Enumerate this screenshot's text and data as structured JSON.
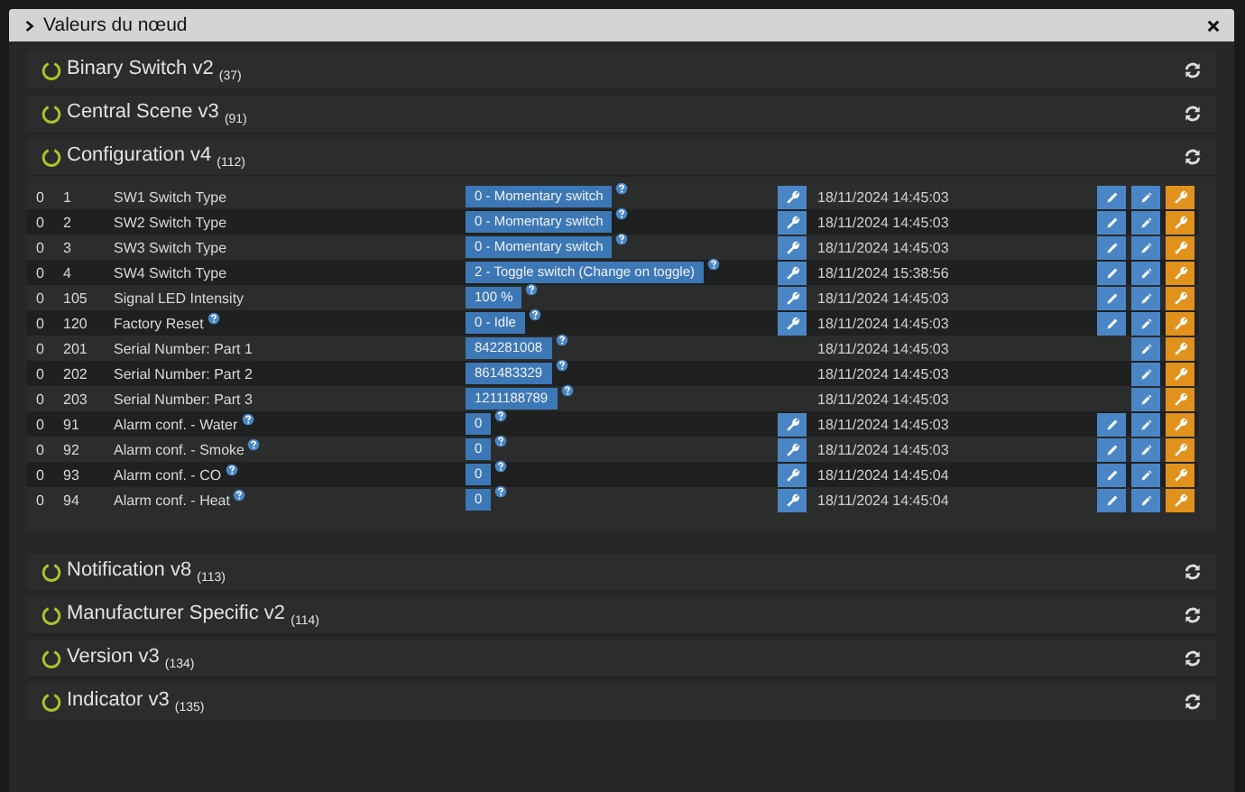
{
  "window": {
    "title": "Valeurs du nœud"
  },
  "sections": [
    {
      "title": "Binary Switch v2 $_{(37)}$"
    },
    {
      "title": "Central Scene v3 $_{(91)}$"
    },
    {
      "title": "Configuration v4 $_{(112)}$",
      "rows": [
        {
          "instance": "0",
          "index": "1",
          "label": "SW1 Switch Type",
          "label_help": false,
          "value": "0 - Momentary switch",
          "set_button": true,
          "timestamp": "18/11/2024 14:45:03",
          "edit_button": true
        },
        {
          "instance": "0",
          "index": "2",
          "label": "SW2 Switch Type",
          "label_help": false,
          "value": "0 - Momentary switch",
          "set_button": true,
          "timestamp": "18/11/2024 14:45:03",
          "edit_button": true
        },
        {
          "instance": "0",
          "index": "3",
          "label": "SW3 Switch Type",
          "label_help": false,
          "value": "0 - Momentary switch",
          "set_button": true,
          "timestamp": "18/11/2024 14:45:03",
          "edit_button": true
        },
        {
          "instance": "0",
          "index": "4",
          "label": "SW4 Switch Type",
          "label_help": false,
          "value": "2 - Toggle switch (Change on toggle)",
          "set_button": true,
          "timestamp": "18/11/2024 15:38:56",
          "edit_button": true
        },
        {
          "instance": "0",
          "index": "105",
          "label": "Signal LED Intensity",
          "label_help": false,
          "value": "100 %",
          "set_button": true,
          "timestamp": "18/11/2024 14:45:03",
          "edit_button": true
        },
        {
          "instance": "0",
          "index": "120",
          "label": "Factory Reset",
          "label_help": true,
          "value": "0 - Idle",
          "set_button": true,
          "timestamp": "18/11/2024 14:45:03",
          "edit_button": true
        },
        {
          "instance": "0",
          "index": "201",
          "label": "Serial Number: Part 1",
          "label_help": false,
          "value": "842281008",
          "set_button": false,
          "timestamp": "18/11/2024 14:45:03",
          "edit_button": false
        },
        {
          "instance": "0",
          "index": "202",
          "label": "Serial Number: Part 2",
          "label_help": false,
          "value": "861483329",
          "set_button": false,
          "timestamp": "18/11/2024 14:45:03",
          "edit_button": false
        },
        {
          "instance": "0",
          "index": "203",
          "label": "Serial Number: Part 3",
          "label_help": false,
          "value": "1211188789",
          "set_button": false,
          "timestamp": "18/11/2024 14:45:03",
          "edit_button": false
        },
        {
          "instance": "0",
          "index": "91",
          "label": "Alarm conf. - Water",
          "label_help": true,
          "value": "0",
          "set_button": true,
          "timestamp": "18/11/2024 14:45:03",
          "edit_button": true
        },
        {
          "instance": "0",
          "index": "92",
          "label": "Alarm conf. - Smoke",
          "label_help": true,
          "value": "0",
          "set_button": true,
          "timestamp": "18/11/2024 14:45:03",
          "edit_button": true
        },
        {
          "instance": "0",
          "index": "93",
          "label": "Alarm conf. - CO",
          "label_help": true,
          "value": "0",
          "set_button": true,
          "timestamp": "18/11/2024 14:45:04",
          "edit_button": true
        },
        {
          "instance": "0",
          "index": "94",
          "label": "Alarm conf. - Heat",
          "label_help": true,
          "value": "0",
          "set_button": true,
          "timestamp": "18/11/2024 14:45:04",
          "edit_button": true
        }
      ]
    },
    {
      "title": "Notification v8 $_{(113)}$"
    },
    {
      "title": "Manufacturer Specific v2 $_{(114)}$"
    },
    {
      "title": "Version v3 $_{(134)}$"
    },
    {
      "title": "Indicator v3 $_{(135)}$"
    }
  ]
}
